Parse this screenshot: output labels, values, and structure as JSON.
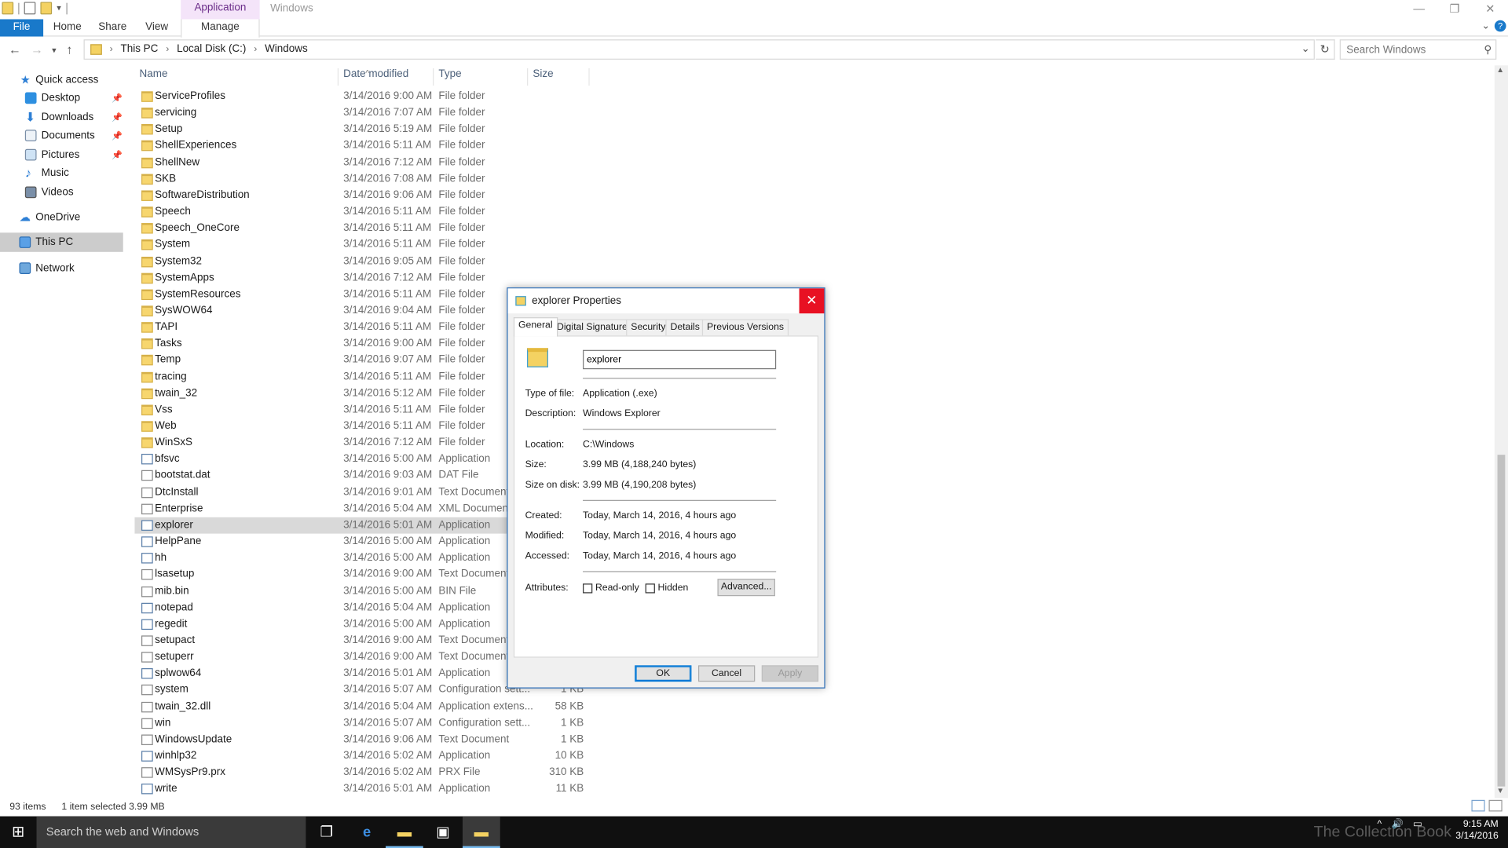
{
  "window": {
    "title": "Windows",
    "context_tab": "Application Tools",
    "ribbon_tabs": [
      "File",
      "Home",
      "Share",
      "View",
      "Manage"
    ]
  },
  "address": {
    "crumbs": [
      "This PC",
      "Local Disk (C:)",
      "Windows"
    ],
    "search_placeholder": "Search Windows"
  },
  "nav_pane": {
    "items": [
      {
        "label": "Quick access",
        "icon": "star-icon"
      },
      {
        "label": "Desktop",
        "icon": "desktop-icon"
      },
      {
        "label": "Downloads",
        "icon": "download-icon"
      },
      {
        "label": "Documents",
        "icon": "documents-icon"
      },
      {
        "label": "Pictures",
        "icon": "pictures-icon"
      },
      {
        "label": "Music",
        "icon": "music-icon"
      },
      {
        "label": "Videos",
        "icon": "videos-icon"
      },
      {
        "label": "OneDrive",
        "icon": "cloud-icon"
      },
      {
        "label": "This PC",
        "icon": "computer-icon"
      },
      {
        "label": "Network",
        "icon": "network-icon"
      }
    ]
  },
  "columns": [
    "Name",
    "Date modified",
    "Type",
    "Size"
  ],
  "files": [
    {
      "name": "ServiceProfiles",
      "date": "3/14/2016 9:00 AM",
      "type": "File folder",
      "size": "",
      "kind": "folder"
    },
    {
      "name": "servicing",
      "date": "3/14/2016 7:07 AM",
      "type": "File folder",
      "size": "",
      "kind": "folder"
    },
    {
      "name": "Setup",
      "date": "3/14/2016 5:19 AM",
      "type": "File folder",
      "size": "",
      "kind": "folder"
    },
    {
      "name": "ShellExperiences",
      "date": "3/14/2016 5:11 AM",
      "type": "File folder",
      "size": "",
      "kind": "folder"
    },
    {
      "name": "ShellNew",
      "date": "3/14/2016 7:12 AM",
      "type": "File folder",
      "size": "",
      "kind": "folder"
    },
    {
      "name": "SKB",
      "date": "3/14/2016 7:08 AM",
      "type": "File folder",
      "size": "",
      "kind": "folder"
    },
    {
      "name": "SoftwareDistribution",
      "date": "3/14/2016 9:06 AM",
      "type": "File folder",
      "size": "",
      "kind": "folder"
    },
    {
      "name": "Speech",
      "date": "3/14/2016 5:11 AM",
      "type": "File folder",
      "size": "",
      "kind": "folder"
    },
    {
      "name": "Speech_OneCore",
      "date": "3/14/2016 5:11 AM",
      "type": "File folder",
      "size": "",
      "kind": "folder"
    },
    {
      "name": "System",
      "date": "3/14/2016 5:11 AM",
      "type": "File folder",
      "size": "",
      "kind": "folder"
    },
    {
      "name": "System32",
      "date": "3/14/2016 9:05 AM",
      "type": "File folder",
      "size": "",
      "kind": "folder"
    },
    {
      "name": "SystemApps",
      "date": "3/14/2016 7:12 AM",
      "type": "File folder",
      "size": "",
      "kind": "folder"
    },
    {
      "name": "SystemResources",
      "date": "3/14/2016 5:11 AM",
      "type": "File folder",
      "size": "",
      "kind": "folder"
    },
    {
      "name": "SysWOW64",
      "date": "3/14/2016 9:04 AM",
      "type": "File folder",
      "size": "",
      "kind": "folder"
    },
    {
      "name": "TAPI",
      "date": "3/14/2016 5:11 AM",
      "type": "File folder",
      "size": "",
      "kind": "folder"
    },
    {
      "name": "Tasks",
      "date": "3/14/2016 9:00 AM",
      "type": "File folder",
      "size": "",
      "kind": "folder"
    },
    {
      "name": "Temp",
      "date": "3/14/2016 9:07 AM",
      "type": "File folder",
      "size": "",
      "kind": "folder"
    },
    {
      "name": "tracing",
      "date": "3/14/2016 5:11 AM",
      "type": "File folder",
      "size": "",
      "kind": "folder"
    },
    {
      "name": "twain_32",
      "date": "3/14/2016 5:12 AM",
      "type": "File folder",
      "size": "",
      "kind": "folder"
    },
    {
      "name": "Vss",
      "date": "3/14/2016 5:11 AM",
      "type": "File folder",
      "size": "",
      "kind": "folder"
    },
    {
      "name": "Web",
      "date": "3/14/2016 5:11 AM",
      "type": "File folder",
      "size": "",
      "kind": "folder"
    },
    {
      "name": "WinSxS",
      "date": "3/14/2016 7:12 AM",
      "type": "File folder",
      "size": "",
      "kind": "folder"
    },
    {
      "name": "bfsvc",
      "date": "3/14/2016 5:00 AM",
      "type": "Application",
      "size": "",
      "kind": "app"
    },
    {
      "name": "bootstat.dat",
      "date": "3/14/2016 9:03 AM",
      "type": "DAT File",
      "size": "",
      "kind": "doc"
    },
    {
      "name": "DtcInstall",
      "date": "3/14/2016 9:01 AM",
      "type": "Text Document",
      "size": "",
      "kind": "doc"
    },
    {
      "name": "Enterprise",
      "date": "3/14/2016 5:04 AM",
      "type": "XML Document",
      "size": "",
      "kind": "doc"
    },
    {
      "name": "explorer",
      "date": "3/14/2016 5:01 AM",
      "type": "Application",
      "size": "",
      "kind": "app"
    },
    {
      "name": "HelpPane",
      "date": "3/14/2016 5:00 AM",
      "type": "Application",
      "size": "",
      "kind": "app"
    },
    {
      "name": "hh",
      "date": "3/14/2016 5:00 AM",
      "type": "Application",
      "size": "",
      "kind": "app"
    },
    {
      "name": "lsasetup",
      "date": "3/14/2016 9:00 AM",
      "type": "Text Document",
      "size": "",
      "kind": "doc"
    },
    {
      "name": "mib.bin",
      "date": "3/14/2016 5:00 AM",
      "type": "BIN File",
      "size": "",
      "kind": "doc"
    },
    {
      "name": "notepad",
      "date": "3/14/2016 5:04 AM",
      "type": "Application",
      "size": "",
      "kind": "app"
    },
    {
      "name": "regedit",
      "date": "3/14/2016 5:00 AM",
      "type": "Application",
      "size": "",
      "kind": "app"
    },
    {
      "name": "setupact",
      "date": "3/14/2016 9:00 AM",
      "type": "Text Document",
      "size": "",
      "kind": "doc"
    },
    {
      "name": "setuperr",
      "date": "3/14/2016 9:00 AM",
      "type": "Text Document",
      "size": "",
      "kind": "doc"
    },
    {
      "name": "splwow64",
      "date": "3/14/2016 5:01 AM",
      "type": "Application",
      "size": "",
      "kind": "app"
    },
    {
      "name": "system",
      "date": "3/14/2016 5:07 AM",
      "type": "Configuration sett...",
      "size": "1 KB",
      "kind": "doc"
    },
    {
      "name": "twain_32.dll",
      "date": "3/14/2016 5:04 AM",
      "type": "Application extens...",
      "size": "58 KB",
      "kind": "doc"
    },
    {
      "name": "win",
      "date": "3/14/2016 5:07 AM",
      "type": "Configuration sett...",
      "size": "1 KB",
      "kind": "doc"
    },
    {
      "name": "WindowsUpdate",
      "date": "3/14/2016 9:06 AM",
      "type": "Text Document",
      "size": "1 KB",
      "kind": "doc"
    },
    {
      "name": "winhlp32",
      "date": "3/14/2016 5:02 AM",
      "type": "Application",
      "size": "10 KB",
      "kind": "app"
    },
    {
      "name": "WMSysPr9.prx",
      "date": "3/14/2016 5:02 AM",
      "type": "PRX File",
      "size": "310 KB",
      "kind": "doc"
    },
    {
      "name": "write",
      "date": "3/14/2016 5:01 AM",
      "type": "Application",
      "size": "11 KB",
      "kind": "app"
    }
  ],
  "selected_file": "explorer",
  "status": {
    "count": "93 items",
    "selection": "1 item selected  3.99 MB"
  },
  "dialog": {
    "title": "explorer Properties",
    "tabs": [
      "General",
      "Digital Signatures",
      "Security",
      "Details",
      "Previous Versions"
    ],
    "active_tab": "General",
    "name_value": "explorer",
    "props": [
      {
        "label": "Type of file:",
        "value": "Application (.exe)"
      },
      {
        "label": "Description:",
        "value": "Windows Explorer"
      },
      {
        "label": "Location:",
        "value": "C:\\Windows"
      },
      {
        "label": "Size:",
        "value": "3.99 MB (4,188,240 bytes)"
      },
      {
        "label": "Size on disk:",
        "value": "3.99 MB (4,190,208 bytes)"
      },
      {
        "label": "Created:",
        "value": "Today, March 14, 2016, 4 hours ago"
      },
      {
        "label": "Modified:",
        "value": "Today, March 14, 2016, 4 hours ago"
      },
      {
        "label": "Accessed:",
        "value": "Today, March 14, 2016, 4 hours ago"
      }
    ],
    "attributes_label": "Attributes:",
    "readonly_label": "Read-only",
    "hidden_label": "Hidden",
    "advanced_label": "Advanced...",
    "ok_label": "OK",
    "cancel_label": "Cancel",
    "apply_label": "Apply"
  },
  "taskbar": {
    "search_placeholder": "Search the web and Windows",
    "watermark": "The Collection Book",
    "time": "9:15 AM",
    "date": "3/14/2016"
  },
  "colors": {
    "accent": "#1979ca",
    "context_tab_bg": "#f4e4f9",
    "close_red": "#e81123",
    "taskbar": "#101010"
  }
}
